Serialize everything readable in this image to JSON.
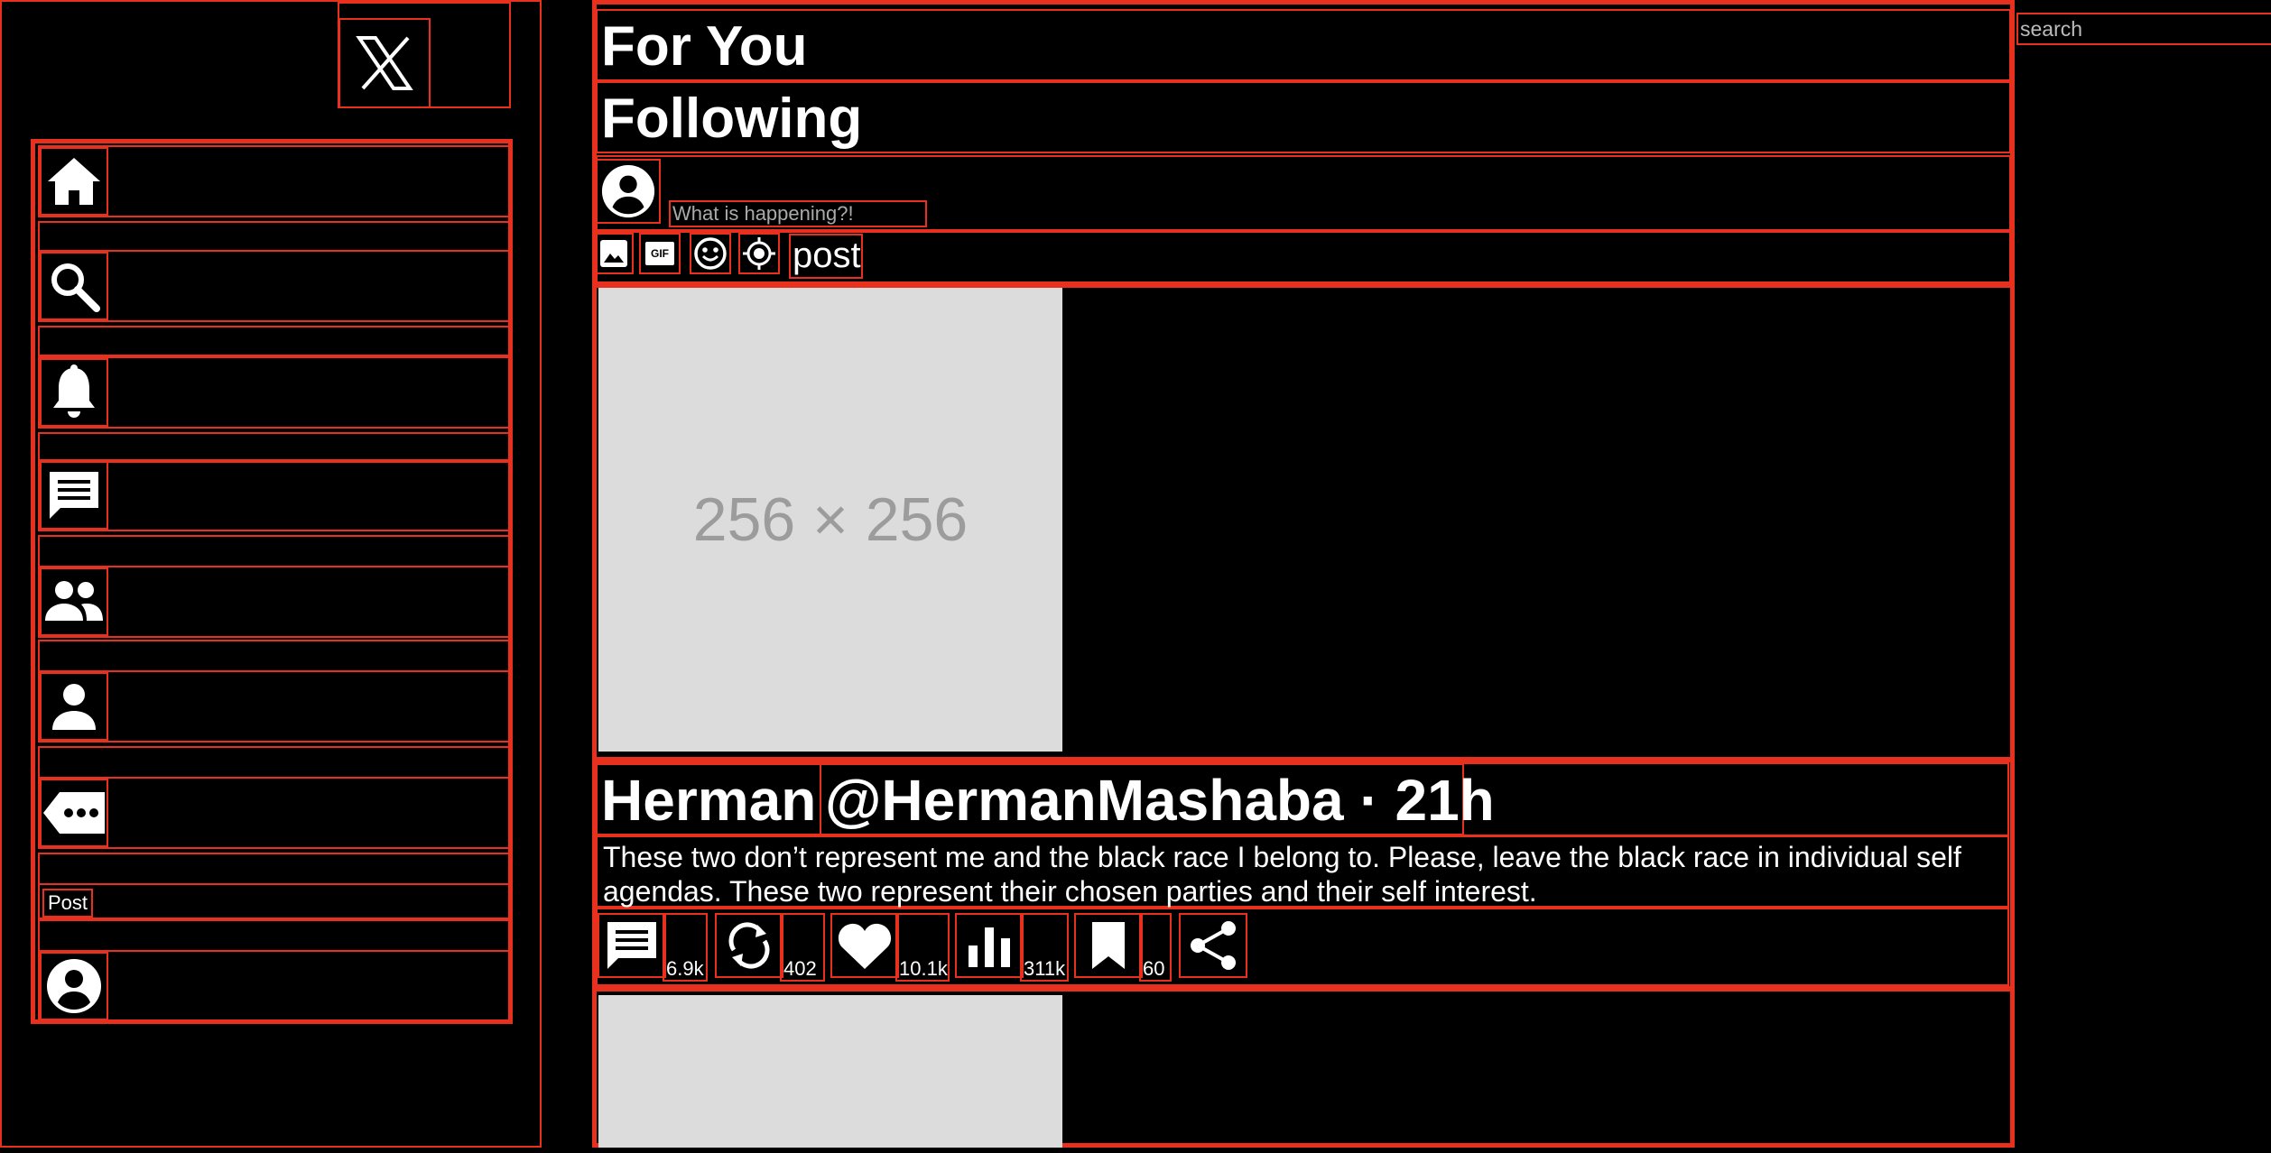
{
  "app": {
    "brand_color": "#e8301f",
    "background": "#000000"
  },
  "sidebar": {
    "logo_icon": "x-logo-icon",
    "items": [
      {
        "icon": "home-icon"
      },
      {
        "icon": "search-icon"
      },
      {
        "icon": "bell-icon"
      },
      {
        "icon": "message-icon"
      },
      {
        "icon": "people-icon"
      },
      {
        "icon": "person-icon"
      },
      {
        "icon": "more-icon"
      }
    ],
    "post_label": "Post",
    "profile_icon": "account-circle-icon"
  },
  "tabs": [
    {
      "label": "For You"
    },
    {
      "label": "Following"
    }
  ],
  "composer": {
    "placeholder": "What is happening?!",
    "tools": [
      "image-icon",
      "gif-icon",
      "emoji-icon",
      "location-icon"
    ],
    "gif_text": "GIF",
    "post_button": "post"
  },
  "feed": {
    "posts": [
      {
        "image_label": "256 × 256",
        "name": "Herman",
        "handle_time": "@HermanMashaba · 21h",
        "text": "These two don’t represent me and the black race I belong to. Please, leave the black race in individual self agendas. These two represent their chosen parties and their self interest.",
        "actions": {
          "replies": "6.9k",
          "reposts": "402",
          "likes": "10.1k",
          "views": "311k",
          "bookmarks": "60"
        }
      }
    ]
  },
  "right": {
    "search_placeholder": "search"
  }
}
